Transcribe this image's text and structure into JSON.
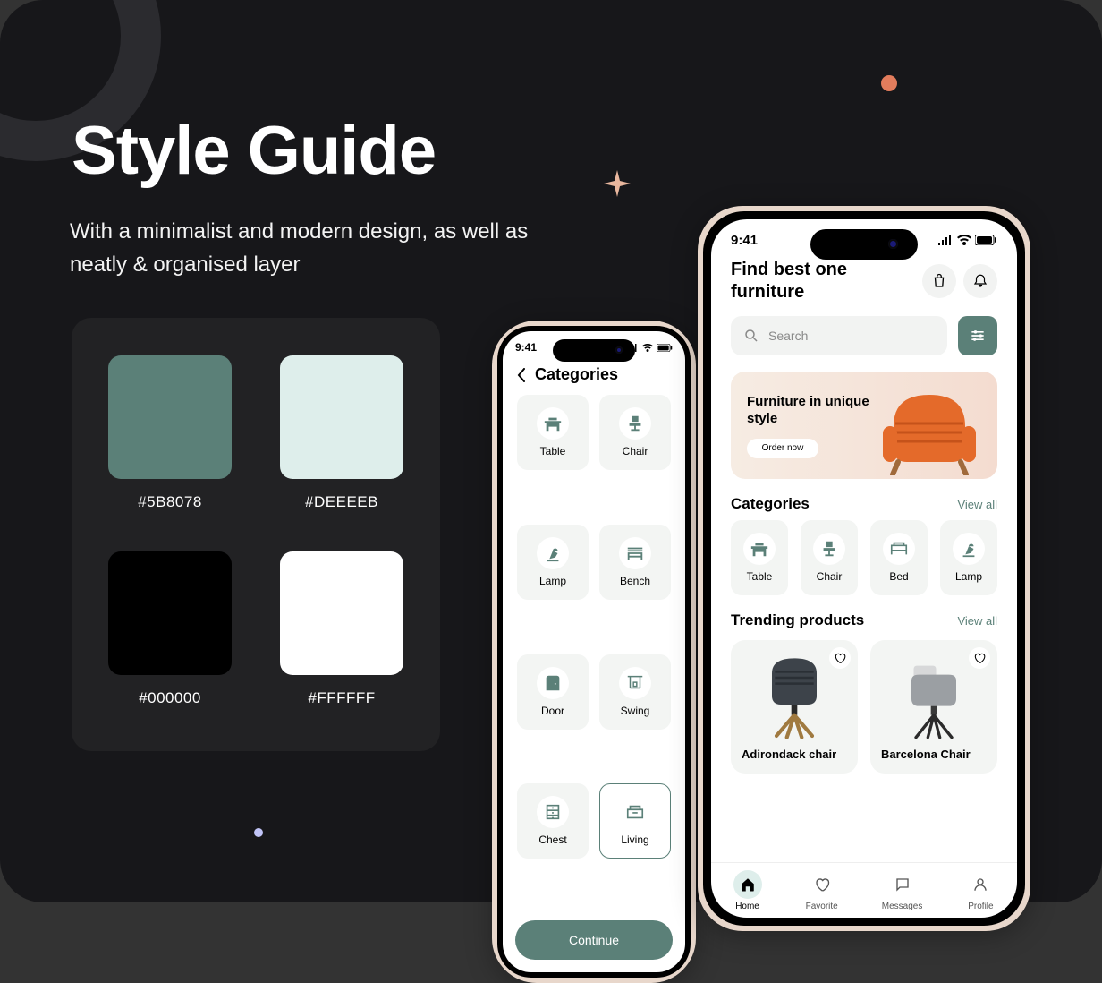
{
  "title": "Style Guide",
  "subtitle": "With a minimalist and modern design, as well as neatly & organised layer",
  "palette": [
    {
      "hex": "#5B8078"
    },
    {
      "hex": "#DEEEEB"
    },
    {
      "hex": "#000000"
    },
    {
      "hex": "#FFFFFF"
    }
  ],
  "status_time": "9:41",
  "categories_screen": {
    "title": "Categories",
    "items": [
      {
        "label": "Table"
      },
      {
        "label": "Chair"
      },
      {
        "label": "Lamp"
      },
      {
        "label": "Bench"
      },
      {
        "label": "Door"
      },
      {
        "label": "Swing"
      },
      {
        "label": "Chest"
      },
      {
        "label": "Living"
      }
    ],
    "continue_label": "Continue"
  },
  "home_screen": {
    "heading": "Find best one furniture",
    "search_placeholder": "Search",
    "banner": {
      "title": "Furniture in unique style",
      "cta": "Order now"
    },
    "categories_title": "Categories",
    "view_all": "View all",
    "categories": [
      {
        "label": "Table"
      },
      {
        "label": "Chair"
      },
      {
        "label": "Bed"
      },
      {
        "label": "Lamp"
      }
    ],
    "trending_title": "Trending products",
    "products": [
      {
        "name": "Adirondack chair"
      },
      {
        "name": "Barcelona Chair"
      }
    ],
    "nav": [
      {
        "label": "Home"
      },
      {
        "label": "Favorite"
      },
      {
        "label": "Messages"
      },
      {
        "label": "Profile"
      }
    ]
  }
}
